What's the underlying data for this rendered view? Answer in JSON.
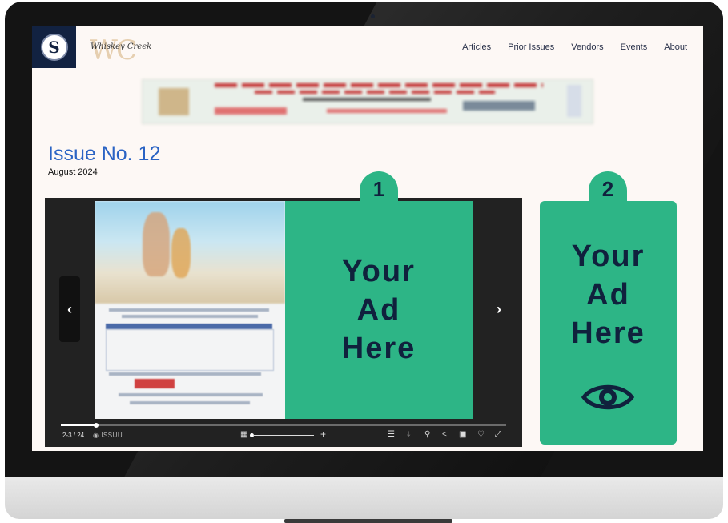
{
  "brand": {
    "logo_letter": "S",
    "mark": "WC",
    "script_name": "Whiskey Creek"
  },
  "nav": {
    "items": [
      "Articles",
      "Prior Issues",
      "Vendors",
      "Events",
      "About"
    ]
  },
  "issue": {
    "title": "Issue No. 12",
    "date": "August 2024"
  },
  "reader": {
    "prev_label": "‹",
    "next_label": "›",
    "page_indicator": "2-3 / 24",
    "provider": "ISSUU",
    "progress": 0.08,
    "zoom_plus": "+",
    "ad_text": "Your Ad Here"
  },
  "ads": {
    "badge_1": "1",
    "badge_2": "2",
    "side_text": "Your Ad Here"
  },
  "colors": {
    "ad_green": "#2db586",
    "ad_text": "#10213d",
    "title_blue": "#2a63c4",
    "logo_navy": "#122241"
  }
}
